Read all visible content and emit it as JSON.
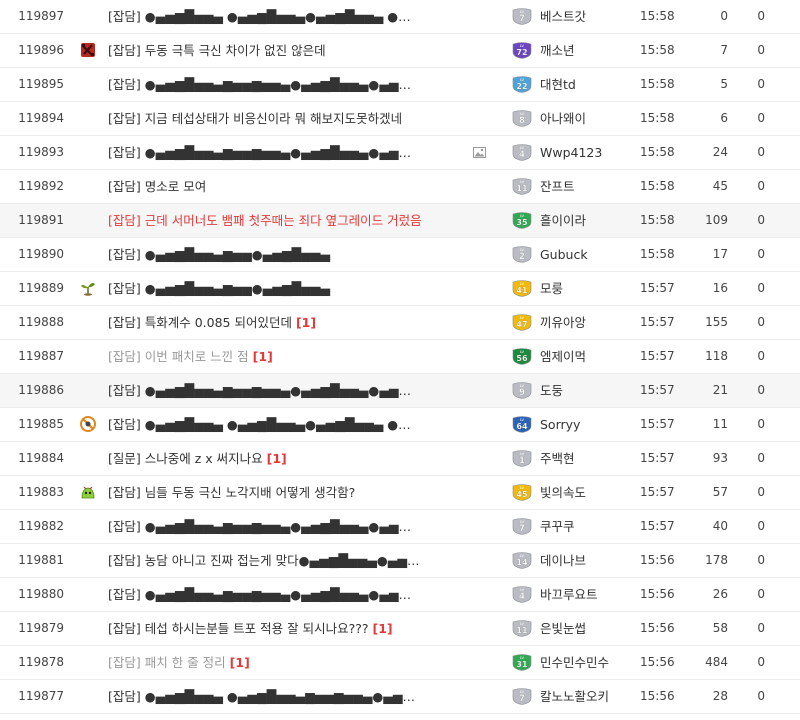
{
  "lv_colors": {
    "gray": "#b9bcc2",
    "blue": "#4fa3d6",
    "purple": "#6b46c1",
    "green": "#33a853",
    "yellow": "#f0b90b",
    "darkgreen": "#1e8a3e",
    "navy": "#2c63b5"
  },
  "posts": [
    {
      "num": "119897",
      "category_icon": null,
      "subject": "[잡담] ●▄▅▆█▅▅▄ ●▄▅▆█▅▅▄●▄▅▆█▅▅▄ ●…",
      "comments": "",
      "subject_style": "normal",
      "has_image": false,
      "level": "7",
      "level_color": "gray",
      "author": "베스트갓",
      "time": "15:58",
      "views": "0",
      "votes": "0"
    },
    {
      "num": "119896",
      "category_icon": "dota-icon",
      "subject": "[잡담] 두동 극특 극신 차이가 없진 않은데",
      "comments": "",
      "subject_style": "normal",
      "has_image": false,
      "level": "72",
      "level_color": "purple",
      "author": "깨소년",
      "time": "15:58",
      "views": "7",
      "votes": "0"
    },
    {
      "num": "119895",
      "category_icon": null,
      "subject": "[잡담] ●▄▅▆█▅▅▄▆▅▅▆▅▅▄●▄▅▆█▅▅▄●▄▅…",
      "comments": "",
      "subject_style": "normal",
      "has_image": false,
      "level": "22",
      "level_color": "blue",
      "author": "대현td",
      "time": "15:58",
      "views": "5",
      "votes": "0"
    },
    {
      "num": "119894",
      "category_icon": null,
      "subject": "[잡담] 지금 테섭상태가 비응신이라 뭐 해보지도못하겠네",
      "comments": "",
      "subject_style": "normal",
      "has_image": false,
      "level": "8",
      "level_color": "gray",
      "author": "아나왜이",
      "time": "15:58",
      "views": "6",
      "votes": "0"
    },
    {
      "num": "119893",
      "category_icon": null,
      "subject": "[잡담] ●▄▅▆█▅▅▄▆▅▅▆▅▅▄●▄▅▆█▅▅▄●▄▅…",
      "comments": "",
      "subject_style": "normal",
      "has_image": true,
      "level": "4",
      "level_color": "gray",
      "author": "Wwp4123",
      "time": "15:58",
      "views": "24",
      "votes": "0"
    },
    {
      "num": "119892",
      "category_icon": null,
      "subject": "[잡담] 명소로 모여",
      "comments": "",
      "subject_style": "normal",
      "has_image": false,
      "level": "11",
      "level_color": "gray",
      "author": "잔프트",
      "time": "15:58",
      "views": "45",
      "votes": "0"
    },
    {
      "num": "119891",
      "category_icon": null,
      "subject": "[잡담] 근데 서머너도 뱀패 첫주때는 죄다 옆그레이드 거렀음",
      "comments": "",
      "subject_style": "hot",
      "has_image": false,
      "level": "35",
      "level_color": "green",
      "author": "흘이이라",
      "time": "15:58",
      "views": "109",
      "votes": "0"
    },
    {
      "num": "119890",
      "category_icon": null,
      "subject": "[잡담] ●▄▅▆█▅▅▄▆▅▅●▄▅▆█▅▅▄",
      "comments": "",
      "subject_style": "normal",
      "has_image": false,
      "level": "2",
      "level_color": "gray",
      "author": "Gubuck",
      "time": "15:58",
      "views": "17",
      "votes": "0"
    },
    {
      "num": "119889",
      "category_icon": "sprout-icon",
      "subject": "[잡담] ●▄▅▆█▅▅▄▆▅▅●▄▅▆█▅▅▄",
      "comments": "",
      "subject_style": "normal",
      "has_image": false,
      "level": "41",
      "level_color": "yellow",
      "author": "모룽",
      "time": "15:57",
      "views": "16",
      "votes": "0"
    },
    {
      "num": "119888",
      "category_icon": null,
      "subject": "[잡담] 특화계수 0.085 되어있던데",
      "comments": "[1]",
      "subject_style": "normal",
      "has_image": false,
      "level": "47",
      "level_color": "yellow",
      "author": "끼유아앙",
      "time": "15:57",
      "views": "155",
      "votes": "0"
    },
    {
      "num": "119887",
      "category_icon": null,
      "subject": "[잡담] 이번 패치로 느낀 점",
      "comments": "[1]",
      "subject_style": "read",
      "has_image": false,
      "level": "56",
      "level_color": "darkgreen",
      "author": "엠제이먹",
      "time": "15:57",
      "views": "118",
      "votes": "0"
    },
    {
      "num": "119886",
      "category_icon": null,
      "subject": "[잡담] ●▄▅▆█▅▅▄▆▅▅▆▅▅▄●▄▅▆█▅▅▄●▄▅…",
      "comments": "",
      "subject_style": "normal",
      "has_image": false,
      "level": "9",
      "level_color": "gray",
      "author": "도둥",
      "time": "15:57",
      "views": "21",
      "votes": "0",
      "highlight": true
    },
    {
      "num": "119885",
      "category_icon": "no-sign-icon",
      "subject": "[잡담] ●▄▅▆█▅▅▄ ●▄▅▆█▅▅▄●▄▅▆█▅▅▄ ●…",
      "comments": "",
      "subject_style": "normal",
      "has_image": false,
      "level": "64",
      "level_color": "navy",
      "author": "Sorryy",
      "time": "15:57",
      "views": "11",
      "votes": "0"
    },
    {
      "num": "119884",
      "category_icon": null,
      "subject": "[질문] 스나중에 z x 써지나요",
      "comments": "[1]",
      "subject_style": "normal",
      "has_image": false,
      "level": "1",
      "level_color": "gray",
      "author": "주백현",
      "time": "15:57",
      "views": "93",
      "votes": "0"
    },
    {
      "num": "119883",
      "category_icon": "slime-icon",
      "subject": "[잡담] 님들 두동 극신 노각지배 어떻게 생각함?",
      "comments": "",
      "subject_style": "normal",
      "has_image": false,
      "level": "45",
      "level_color": "yellow",
      "author": "빛의속도",
      "time": "15:57",
      "views": "57",
      "votes": "0"
    },
    {
      "num": "119882",
      "category_icon": null,
      "subject": "[잡담] ●▄▅▆█▅▅▄▆▅▅▆▅▅▄●▄▅▆█▅▅▄●▄▅…",
      "comments": "",
      "subject_style": "normal",
      "has_image": false,
      "level": "7",
      "level_color": "gray",
      "author": "쿠꾸쿠",
      "time": "15:57",
      "views": "40",
      "votes": "0"
    },
    {
      "num": "119881",
      "category_icon": null,
      "subject": "[잡담] 농담 아니고 진짜 접는게 맞다●▄▅▆█▅▅▄●▄▅…",
      "comments": "",
      "subject_style": "normal",
      "has_image": false,
      "level": "14",
      "level_color": "gray",
      "author": "데이나브",
      "time": "15:56",
      "views": "178",
      "votes": "0"
    },
    {
      "num": "119880",
      "category_icon": null,
      "subject": "[잡담] ●▄▅▆█▅▅▄▆▅▅▆▅▅▄●▄▅▆█▅▅▄●▄▅…",
      "comments": "",
      "subject_style": "normal",
      "has_image": false,
      "level": "4",
      "level_color": "gray",
      "author": "바끄루요트",
      "time": "15:56",
      "views": "26",
      "votes": "0"
    },
    {
      "num": "119879",
      "category_icon": null,
      "subject": "[잡담] 테섭 하시는분들 트포 적용 잘 되시나요???",
      "comments": "[1]",
      "subject_style": "normal",
      "has_image": false,
      "level": "11",
      "level_color": "gray",
      "author": "은빛눈썹",
      "time": "15:56",
      "views": "58",
      "votes": "0"
    },
    {
      "num": "119878",
      "category_icon": null,
      "subject": "[잡담] 패치 한 줄 정리",
      "comments": "[1]",
      "subject_style": "read",
      "has_image": false,
      "level": "31",
      "level_color": "green",
      "author": "민수민수민수",
      "time": "15:56",
      "views": "484",
      "votes": "0"
    },
    {
      "num": "119877",
      "category_icon": null,
      "subject": "[잡담] ●▄▅▆█▅▅▄ ●▄▅▆█▅▅▄▆▅▅▆▅▅▄●▄▅…",
      "comments": "",
      "subject_style": "normal",
      "has_image": false,
      "level": "7",
      "level_color": "gray",
      "author": "칼노노활오키",
      "time": "15:56",
      "views": "28",
      "votes": "0"
    }
  ]
}
